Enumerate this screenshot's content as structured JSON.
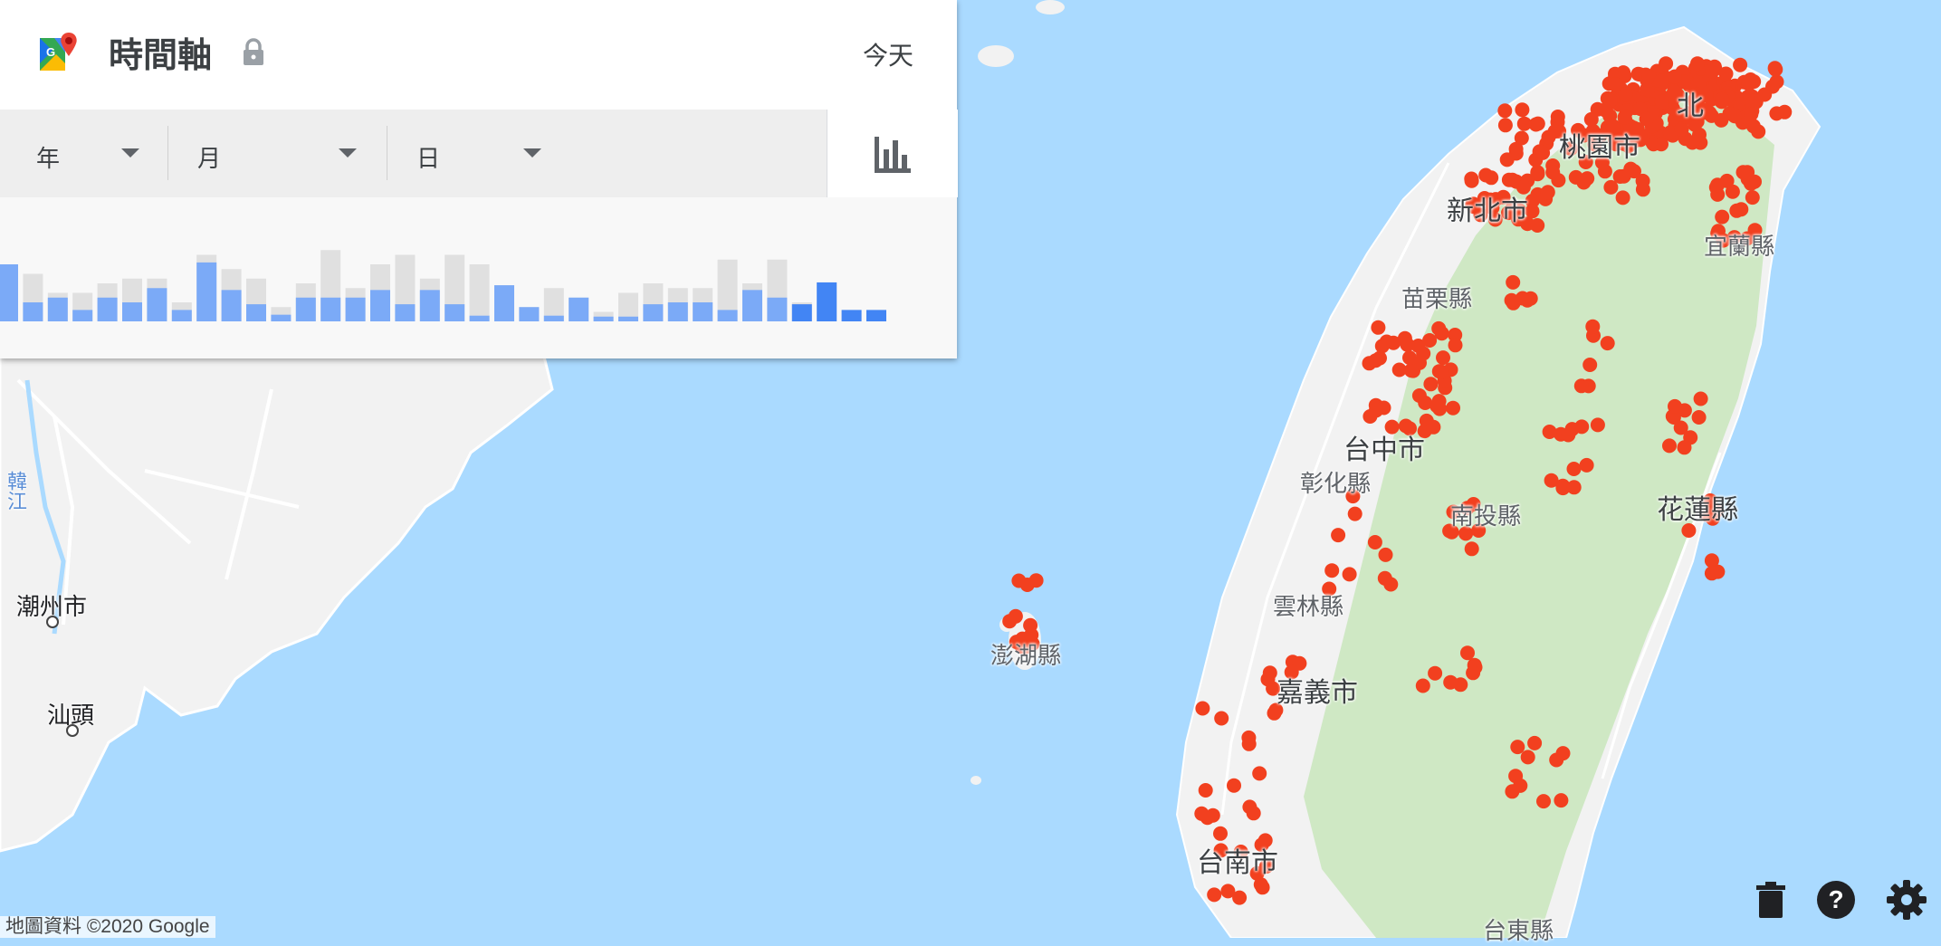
{
  "map": {
    "labels": {
      "taipei_partial": "北",
      "taoyuan": "桃園市",
      "new_taipei": "新北市",
      "yilan": "宜蘭縣",
      "miaoli": "苗栗縣",
      "taichung": "台中市",
      "changhua": "彰化縣",
      "nantou": "南投縣",
      "hualien": "花蓮縣",
      "yunlin": "雲林縣",
      "chiayi": "嘉義市",
      "penghu": "澎湖縣",
      "tainan": "台南市",
      "taitung": "台東縣",
      "chaozhou": "潮州市",
      "shantou": "汕頭",
      "hanjiang": "韓江"
    },
    "location_marker_color": "#f2401f",
    "land_color": "#f2f2f2",
    "mountain_color": "#cfe8c4",
    "water_color": "#aadaff"
  },
  "timeline": {
    "title": "時間軸",
    "today_label": "今天",
    "selectors": [
      {
        "label": "年"
      },
      {
        "label": "月"
      },
      {
        "label": "日"
      }
    ]
  },
  "bar_chart": {
    "grey_totals": [
      6,
      5,
      3,
      3,
      4,
      4.5,
      4.5,
      2,
      7,
      5.5,
      4.5,
      1.5,
      4,
      7.5,
      3.5,
      6,
      7,
      4.5,
      7,
      6,
      2,
      1,
      3.5,
      1,
      1,
      3,
      4,
      3.5,
      3.5,
      6.5,
      4,
      6.5,
      2,
      2
    ],
    "blue_values": [
      6,
      2,
      2.5,
      1.2,
      2.5,
      2,
      3.5,
      1.2,
      6.2,
      3.3,
      1.8,
      0.7,
      2.5,
      2.5,
      2.5,
      3.3,
      1.8,
      3.3,
      1.8,
      0.6,
      3.8,
      1.5,
      0.6,
      2.5,
      0.5,
      0.5,
      1.8,
      2,
      2,
      1.2,
      3.3,
      2.5,
      1.8,
      4.1,
      1.2,
      1.2
    ],
    "selected_bar_color": "#4285f4",
    "bar_color": "#7baaf7",
    "total_color": "#e0e0e0"
  },
  "footer": {
    "attribution": "地圖資料 ©2020 Google"
  }
}
